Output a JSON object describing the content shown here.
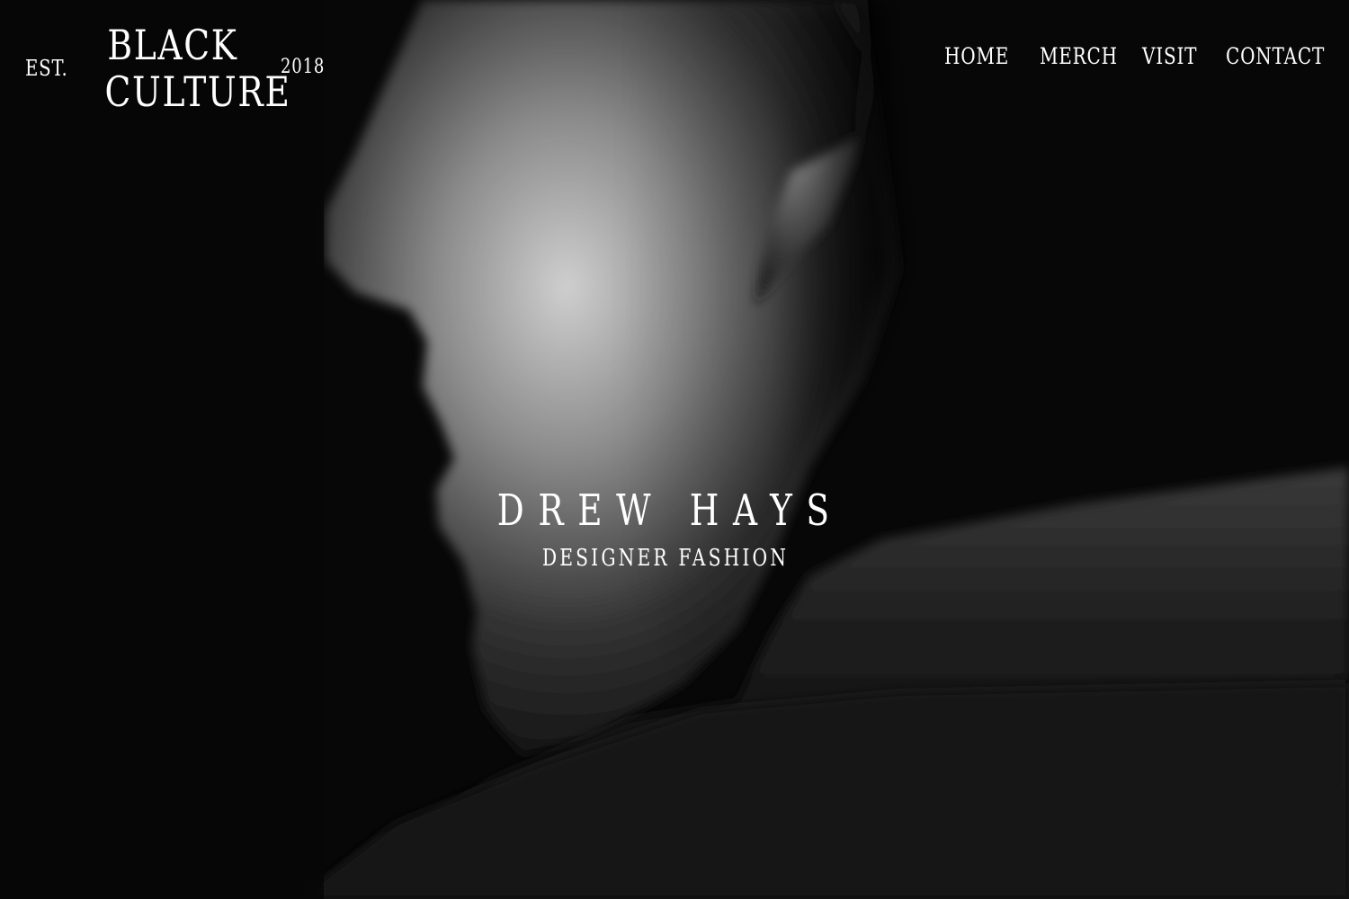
{
  "brand": {
    "est_label": "EST.",
    "name_line1": "BLACK",
    "name_line2": "CULTURE",
    "year": "2018"
  },
  "nav": {
    "items": [
      {
        "label": "HOME"
      },
      {
        "label": "MERCH"
      },
      {
        "label": "VISIT"
      },
      {
        "label": "CONTACT"
      }
    ]
  },
  "hero": {
    "title": "DREW HAYS",
    "subtitle": "DESIGNER FASHION"
  },
  "colors": {
    "background": "#070707",
    "text": "#ffffff"
  }
}
